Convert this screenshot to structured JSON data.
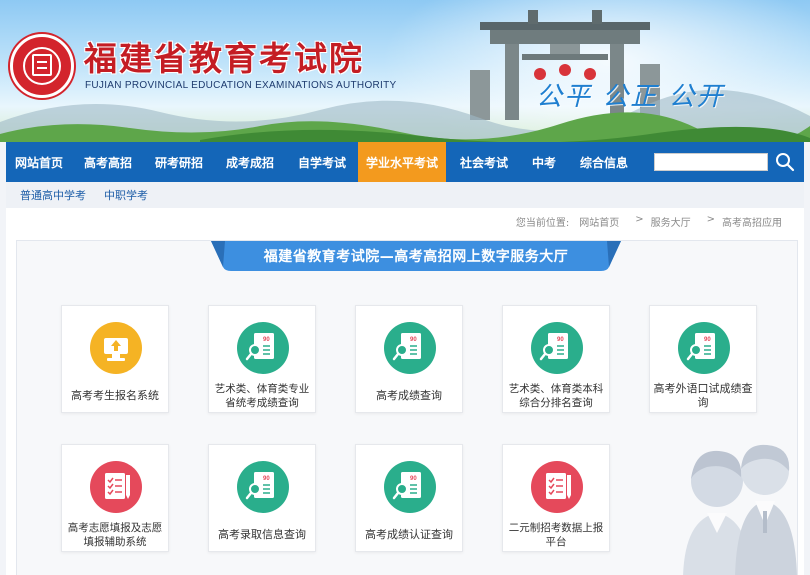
{
  "header": {
    "title": "福建省教育考试院",
    "subtitle": "FUJIAN PROVINCIAL EDUCATION EXAMINATIONS AUTHORITY",
    "slogan": "公平 公正 公开"
  },
  "nav": {
    "items": [
      {
        "label": "网站首页"
      },
      {
        "label": "高考高招"
      },
      {
        "label": "研考研招"
      },
      {
        "label": "成考成招"
      },
      {
        "label": "自学考试"
      },
      {
        "label": "学业水平考试"
      },
      {
        "label": "社会考试"
      },
      {
        "label": "中考"
      },
      {
        "label": "综合信息"
      }
    ],
    "active_index": 5,
    "search_placeholder": ""
  },
  "subnav": {
    "items": [
      {
        "label": "普通高中学考"
      },
      {
        "label": "中职学考"
      }
    ]
  },
  "breadcrumb": {
    "prefix": "您当前位置:",
    "items": [
      "网站首页",
      "服务大厅",
      "高考高招应用"
    ],
    "separator": ">"
  },
  "hall": {
    "banner_title": "福建省教育考试院—高考高招网上数字服务大厅",
    "services": [
      {
        "label": "高考考生报名系统",
        "icon": "upload-icon",
        "color": "#f5b324"
      },
      {
        "label": "艺术类、体育类专业省统考成绩查询",
        "icon": "score-search-icon",
        "color": "#2aae8c"
      },
      {
        "label": "高考成绩查询",
        "icon": "score-search-icon",
        "color": "#2aae8c"
      },
      {
        "label": "艺术类、体育类本科综合分排名查询",
        "icon": "score-search-icon",
        "color": "#2aae8c"
      },
      {
        "label": "高考外语口试成绩查询",
        "icon": "score-search-icon",
        "color": "#2aae8c"
      },
      {
        "label": "高考志愿填报及志愿填报辅助系统",
        "icon": "form-pen-icon",
        "color": "#e5495b"
      },
      {
        "label": "高考录取信息查询",
        "icon": "score-search-icon",
        "color": "#2aae8c"
      },
      {
        "label": "高考成绩认证查询",
        "icon": "score-search-icon",
        "color": "#2aae8c"
      },
      {
        "label": "二元制招考数据上报平台",
        "icon": "form-pen-icon",
        "color": "#e5495b"
      }
    ]
  },
  "colors": {
    "nav_bg": "#1466b8",
    "nav_active": "#f39a1e",
    "title_red": "#c41d24",
    "ribbon_blue": "#3d8fe0"
  }
}
